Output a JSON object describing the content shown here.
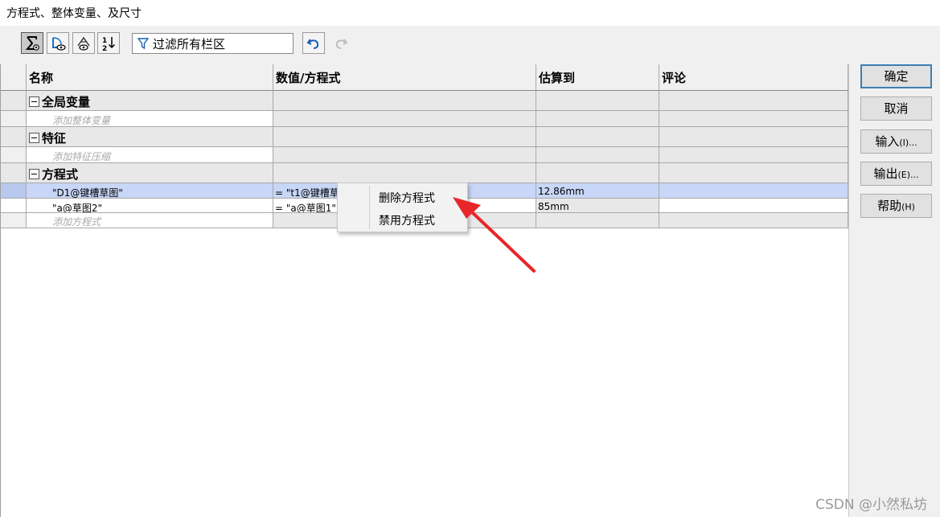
{
  "window": {
    "title": "方程式、整体变量、及尺寸"
  },
  "toolbar": {
    "filter_text": "过滤所有栏区",
    "sort_label_top": "1",
    "sort_label_bottom": "2"
  },
  "table": {
    "headers": [
      "名称",
      "数值/方程式",
      "估算到",
      "评论"
    ],
    "groups": {
      "global": {
        "label": "全局变量",
        "placeholder": "添加整体变量"
      },
      "features": {
        "label": "特征",
        "placeholder": "添加特征压缩"
      },
      "equations": {
        "label": "方程式",
        "placeholder": "添加方程式"
      }
    },
    "rows": [
      {
        "name": "\"D1@键槽草图\"",
        "value": "= \"t1@键槽草",
        "evaluates": "12.86mm"
      },
      {
        "name": "\"a@草图2\"",
        "value": "= \"a@草图1\"",
        "evaluates": "85mm"
      }
    ]
  },
  "buttons": {
    "ok": "确定",
    "cancel": "取消",
    "import": "输入",
    "import_key": "(I)...",
    "export": "输出",
    "export_key": "(E)...",
    "help": "帮助",
    "help_key": "(H)"
  },
  "context_menu": {
    "items": [
      "删除方程式",
      "禁用方程式"
    ]
  },
  "watermark": "CSDN @小然私坊",
  "colors": {
    "selection": "#c8d6f7",
    "arrow": "#e8262a",
    "default_button_border": "#3c7fb1"
  }
}
